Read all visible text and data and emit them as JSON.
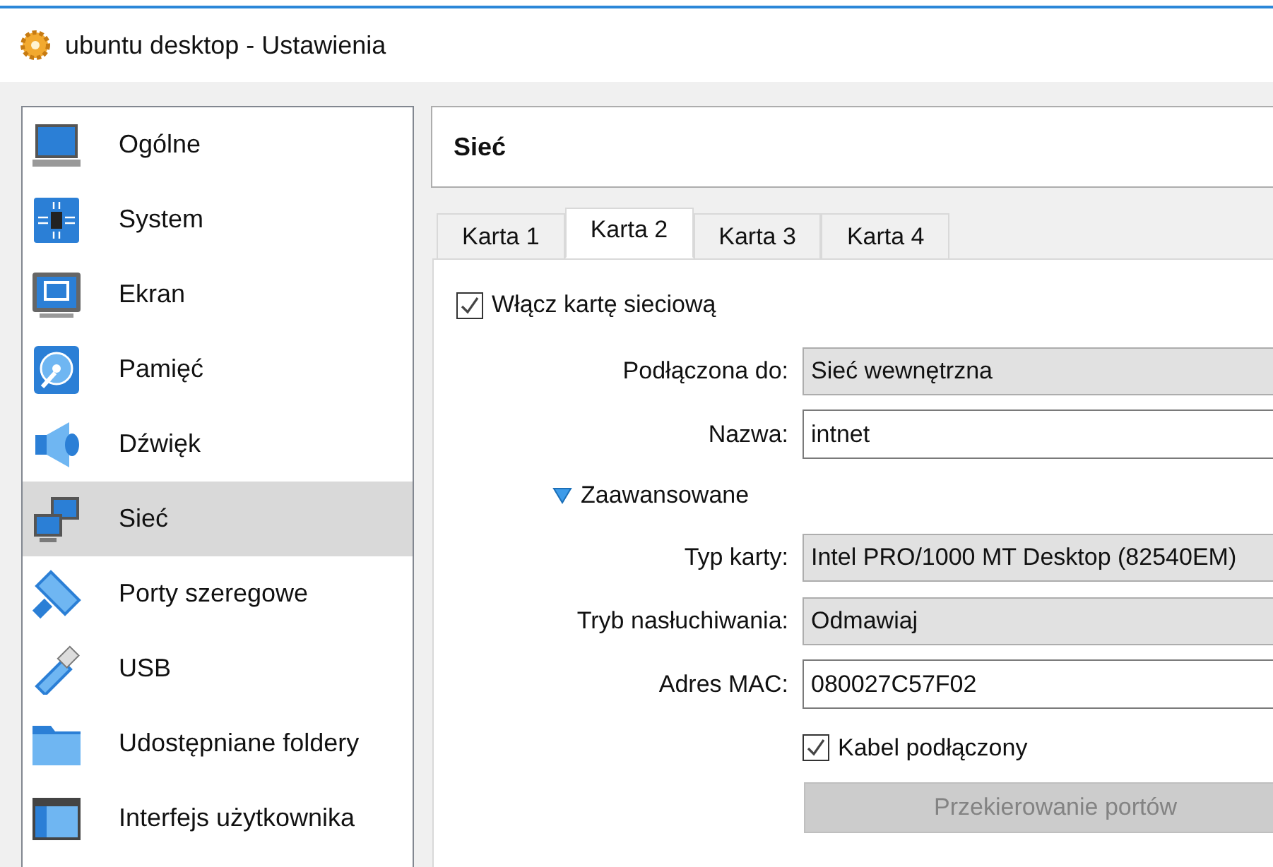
{
  "window": {
    "title": "ubuntu desktop - Ustawienia"
  },
  "sidebar": {
    "items": [
      {
        "label": "Ogólne",
        "kind": "laptop",
        "selected": false
      },
      {
        "label": "System",
        "kind": "chip",
        "selected": false
      },
      {
        "label": "Ekran",
        "kind": "monitor",
        "selected": false
      },
      {
        "label": "Pamięć",
        "kind": "disk",
        "selected": false
      },
      {
        "label": "Dźwięk",
        "kind": "speaker",
        "selected": false
      },
      {
        "label": "Sieć",
        "kind": "network",
        "selected": true
      },
      {
        "label": "Porty szeregowe",
        "kind": "serial",
        "selected": false
      },
      {
        "label": "USB",
        "kind": "usb",
        "selected": false
      },
      {
        "label": "Udostępniane foldery",
        "kind": "folder",
        "selected": false
      },
      {
        "label": "Interfejs użytkownika",
        "kind": "window",
        "selected": false
      }
    ]
  },
  "section_title": "Sieć",
  "tabs": [
    {
      "label": "Karta 1",
      "selected": false
    },
    {
      "label": "Karta 2",
      "selected": true
    },
    {
      "label": "Karta 3",
      "selected": false
    },
    {
      "label": "Karta 4",
      "selected": false
    }
  ],
  "enable_adapter": {
    "label": "Włącz kartę sieciową",
    "checked": true
  },
  "fields": [
    {
      "label": "Podłączona do:",
      "kind": "dropdown",
      "value": "Sieć wewnętrzna"
    },
    {
      "label": "Nazwa:",
      "kind": "input",
      "value": "intnet"
    }
  ],
  "advanced": {
    "label": "Zaawansowane",
    "expanded": true,
    "fields": [
      {
        "label": "Typ karty:",
        "kind": "dropdown",
        "value": "Intel PRO/1000 MT Desktop (82540EM)"
      },
      {
        "label": "Tryb nasłuchiwania:",
        "kind": "dropdown",
        "value": "Odmawiaj"
      },
      {
        "label": "Adres MAC:",
        "kind": "input",
        "value": "080027C57F02"
      }
    ],
    "cable": {
      "label": "Kabel podłączony",
      "checked": true
    },
    "port_forwarding": {
      "label": "Przekierowanie portów",
      "disabled": true
    }
  }
}
